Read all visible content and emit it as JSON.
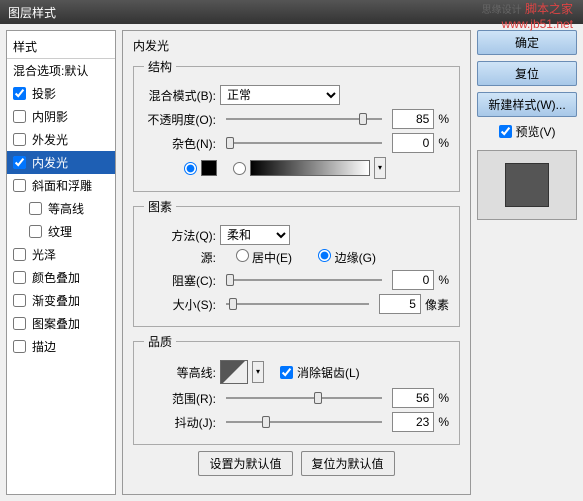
{
  "window_title": "图层样式",
  "watermark": {
    "site": "脚本之家",
    "url": "www.jb51.net",
    "design": "思缘设计"
  },
  "sidebar": {
    "header": "样式",
    "blending": "混合选项:默认",
    "items": [
      {
        "label": "投影",
        "checked": true,
        "indent": false
      },
      {
        "label": "内阴影",
        "checked": false,
        "indent": false
      },
      {
        "label": "外发光",
        "checked": false,
        "indent": false
      },
      {
        "label": "内发光",
        "checked": true,
        "indent": false,
        "selected": true
      },
      {
        "label": "斜面和浮雕",
        "checked": false,
        "indent": false
      },
      {
        "label": "等高线",
        "checked": false,
        "indent": true
      },
      {
        "label": "纹理",
        "checked": false,
        "indent": true
      },
      {
        "label": "光泽",
        "checked": false,
        "indent": false
      },
      {
        "label": "颜色叠加",
        "checked": false,
        "indent": false
      },
      {
        "label": "渐变叠加",
        "checked": false,
        "indent": false
      },
      {
        "label": "图案叠加",
        "checked": false,
        "indent": false
      },
      {
        "label": "描边",
        "checked": false,
        "indent": false
      }
    ]
  },
  "panel": {
    "title": "内发光",
    "structure": {
      "legend": "结构",
      "blend_label": "混合模式(B):",
      "blend_value": "正常",
      "opacity_label": "不透明度(O):",
      "opacity_value": "85",
      "opacity_unit": "%",
      "noise_label": "杂色(N):",
      "noise_value": "0",
      "noise_unit": "%"
    },
    "elements": {
      "legend": "图素",
      "technique_label": "方法(Q):",
      "technique_value": "柔和",
      "source_label": "源:",
      "center": "居中(E)",
      "edge": "边缘(G)",
      "choke_label": "阻塞(C):",
      "choke_value": "0",
      "choke_unit": "%",
      "size_label": "大小(S):",
      "size_value": "5",
      "size_unit": "像素"
    },
    "quality": {
      "legend": "品质",
      "contour_label": "等高线:",
      "antialias": "消除锯齿(L)",
      "range_label": "范围(R):",
      "range_value": "56",
      "range_unit": "%",
      "jitter_label": "抖动(J):",
      "jitter_value": "23",
      "jitter_unit": "%"
    },
    "buttons": {
      "default": "设置为默认值",
      "reset": "复位为默认值"
    }
  },
  "right": {
    "ok": "确定",
    "cancel": "复位",
    "newstyle": "新建样式(W)...",
    "preview": "预览(V)"
  }
}
